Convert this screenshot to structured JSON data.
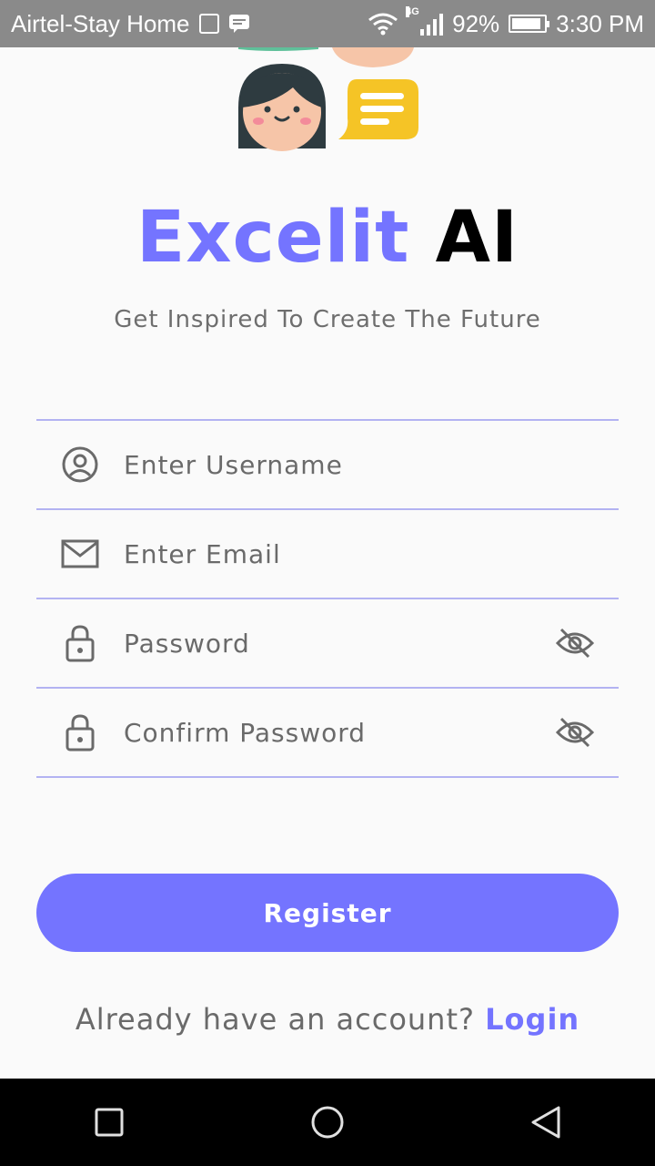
{
  "status_bar": {
    "carrier": "Airtel-Stay Home",
    "network": "4G",
    "battery": "92%",
    "battery_level": 0.92,
    "time": "3:30 PM"
  },
  "app": {
    "title_part1": "Excelit",
    "title_part2": "AI",
    "subtitle": "Get Inspired To Create The Future"
  },
  "form": {
    "username": {
      "placeholder": "Enter Username",
      "icon": "user-circle-icon"
    },
    "email": {
      "placeholder": "Enter Email",
      "icon": "mail-icon"
    },
    "password": {
      "placeholder": "Password",
      "icon": "lock-icon"
    },
    "confirm_password": {
      "placeholder": "Confirm Password",
      "icon": "lock-icon"
    }
  },
  "register_label": "Register",
  "login_prompt": "Already have an account?",
  "login_link": "Login",
  "colors": {
    "accent": "#7474ff",
    "divider": "#b3b3f2",
    "status_bar": "#8a8a8a",
    "nav_bar": "#000000"
  }
}
